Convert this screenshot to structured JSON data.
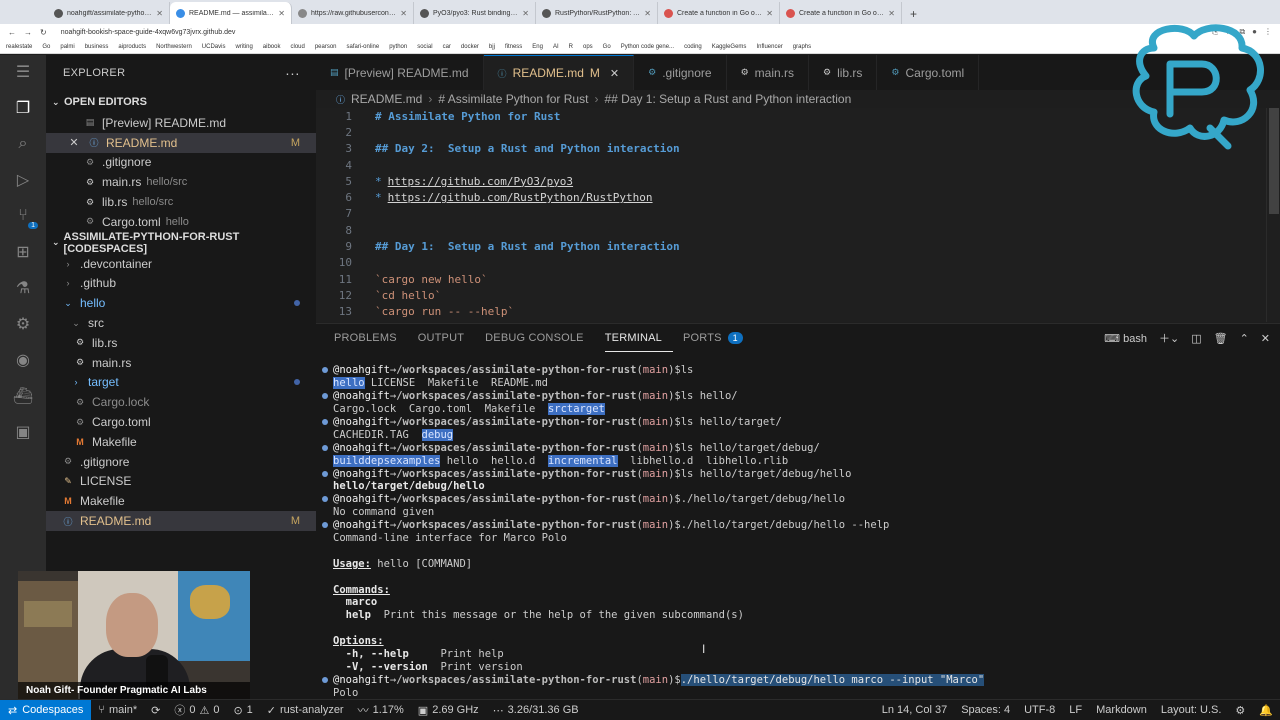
{
  "browser": {
    "tabs": [
      {
        "title": "noahgift/assimilate-python-fo..."
      },
      {
        "title": "README.md — assimilate-pyt...",
        "active": true
      },
      {
        "title": "https://raw.githubuserconten..."
      },
      {
        "title": "PyO3/pyo3: Rust bindings for ..."
      },
      {
        "title": "RustPython/RustPython: A Py..."
      },
      {
        "title": "Create a function in Go or Rus..."
      },
      {
        "title": "Create a function in Go or Rus..."
      }
    ],
    "new_tab": "+",
    "url": "noahgift-bookish-space-guide-4xqw6vg73jvrx.github.dev",
    "bookmarks": [
      "realestate",
      "Go",
      "palmi",
      "business",
      "aiproducts",
      "Northwestern",
      "UCDavis",
      "writing",
      "aibook",
      "cloud",
      "pearson",
      "safari-online",
      "python",
      "social",
      "car",
      "docker",
      "bjj",
      "fitness",
      "Eng",
      "AI",
      "R",
      "ops",
      "Go",
      "Python code gene...",
      "coding",
      "KaggleGems",
      "Influencer",
      "graphs"
    ]
  },
  "explorer": {
    "title": "EXPLORER",
    "more": "···",
    "open_editors": {
      "label": "OPEN EDITORS",
      "items": [
        {
          "name": "[Preview] README.md",
          "desc": "",
          "mod": ""
        },
        {
          "name": "README.md",
          "desc": "",
          "mod": "M"
        },
        {
          "name": ".gitignore",
          "desc": "",
          "mod": ""
        },
        {
          "name": "main.rs",
          "desc": "hello/src",
          "mod": ""
        },
        {
          "name": "lib.rs",
          "desc": "hello/src",
          "mod": ""
        },
        {
          "name": "Cargo.toml",
          "desc": "hello",
          "mod": ""
        }
      ]
    },
    "workspace": {
      "label": "ASSIMILATE-PYTHON-FOR-RUST [CODESPACES]",
      "items": [
        {
          "name": ".devcontainer",
          "mod": ""
        },
        {
          "name": ".github",
          "mod": ""
        },
        {
          "name": "hello",
          "mod": ""
        },
        {
          "name": "src",
          "mod": ""
        },
        {
          "name": "lib.rs",
          "mod": ""
        },
        {
          "name": "main.rs",
          "mod": ""
        },
        {
          "name": "target",
          "mod": ""
        },
        {
          "name": "Cargo.lock",
          "mod": ""
        },
        {
          "name": "Cargo.toml",
          "mod": ""
        },
        {
          "name": "Makefile",
          "mod": ""
        },
        {
          "name": ".gitignore",
          "mod": ""
        },
        {
          "name": "LICENSE",
          "mod": ""
        },
        {
          "name": "Makefile",
          "mod": ""
        },
        {
          "name": "README.md",
          "mod": "M"
        }
      ]
    }
  },
  "activity_badge": "1",
  "webcam_label": "Noah Gift- Founder Pragmatic AI Labs",
  "editor_tabs": [
    {
      "label": "[Preview] README.md",
      "mod": ""
    },
    {
      "label": "README.md",
      "mod": "M"
    },
    {
      "label": ".gitignore",
      "mod": ""
    },
    {
      "label": "main.rs",
      "mod": ""
    },
    {
      "label": "lib.rs",
      "mod": ""
    },
    {
      "label": "Cargo.toml",
      "mod": ""
    }
  ],
  "breadcrumb": [
    "README.md",
    "# Assimilate Python for Rust",
    "## Day 1:  Setup a Rust and Python interaction"
  ],
  "editor_lines": [
    {
      "n": "1",
      "text": "# Assimilate Python for Rust"
    },
    {
      "n": "2",
      "text": ""
    },
    {
      "n": "3",
      "text": "## Day 2:  Setup a Rust and Python interaction"
    },
    {
      "n": "4",
      "text": ""
    },
    {
      "n": "5",
      "bullet": "*",
      "text": "https://github.com/PyO3/pyo3"
    },
    {
      "n": "6",
      "bullet": "*",
      "text": "https://github.com/RustPython/RustPython"
    },
    {
      "n": "7",
      "text": ""
    },
    {
      "n": "8",
      "text": ""
    },
    {
      "n": "9",
      "text": "## Day 1:  Setup a Rust and Python interaction"
    },
    {
      "n": "10",
      "text": ""
    },
    {
      "n": "11",
      "text": "`cargo new hello`"
    },
    {
      "n": "12",
      "text": "`cd hello`"
    },
    {
      "n": "13",
      "text": "`cargo run -- --help`"
    }
  ],
  "panel": {
    "tabs": [
      "PROBLEMS",
      "OUTPUT",
      "DEBUG CONSOLE",
      "TERMINAL",
      "PORTS"
    ],
    "ports_badge": "1",
    "shell": "bash"
  },
  "terminal": {
    "user": "@noahgift",
    "arrow": "→",
    "path": "/workspaces/assimilate-python-for-rust",
    "branch": "main",
    "dollar": "$",
    "cmds": [
      "ls",
      "ls hello/",
      "ls hello/target/",
      "ls hello/target/debug/",
      "ls hello/target/debug/hello",
      "./hello/target/debug/hello",
      "./hello/target/debug/hello --help",
      "./hello/target/debug/hello marco --input \"Marco\""
    ],
    "out_ls": {
      "hl": "hello",
      "rest": " LICENSE  Makefile  README.md"
    },
    "out_lshello": {
      "pre": "Cargo.lock  Cargo.toml  Makefile  ",
      "hl1": "src",
      "hl2": "target"
    },
    "out_lstarget": {
      "pre": "CACHEDIR.TAG  ",
      "hl": "debug"
    },
    "out_lsdebug": {
      "hl1": "build",
      "hl2": "deps",
      "hl3": "examples",
      "mid": " hello  hello.d  ",
      "hl4": "incremental",
      "rest": "  libhello.d  libhello.rlib"
    },
    "out_lshellobin": "hello/target/debug/hello",
    "out_nocmd": "No command given",
    "out_cli": "Command-line interface for Marco Polo",
    "usage_label": "Usage:",
    "usage_rest": " hello [COMMAND]",
    "commands_label": "Commands:",
    "cmd_marco": "  marco",
    "cmd_help": "  help",
    "cmd_help_desc": "  Print this message or the help of the given subcommand(s)",
    "options_label": "Options:",
    "opt_h": "  -h, --help",
    "opt_h_desc": "     Print help",
    "opt_v": "  -V, --version",
    "opt_v_desc": "  Print version",
    "out_polo": "Polo"
  },
  "status": {
    "remote": "Codespaces",
    "branch": "main*",
    "errors": "0",
    "warnings": "0",
    "ports": "1",
    "analyzer": "rust-analyzer",
    "cpu": "1.17%",
    "freq": "2.69 GHz",
    "mem": "3.26/31.36 GB",
    "position": "Ln 14, Col 37",
    "spaces": "Spaces: 4",
    "encoding": "UTF-8",
    "eol": "LF",
    "language": "Markdown",
    "layout": "Layout: U.S."
  },
  "colors": {
    "accent": "#0078d4",
    "modified": "#e2c08d",
    "heading": "#569cd6"
  }
}
